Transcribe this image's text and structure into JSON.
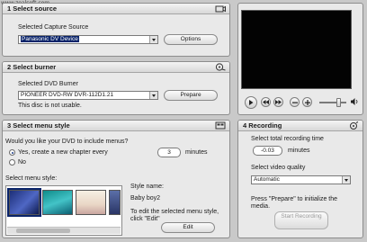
{
  "watermark": "www.zealsoft.com",
  "source": {
    "title": "1 Select source",
    "label": "Selected Capture Source",
    "value": "Panasonic DV Device",
    "button": "Options"
  },
  "burner": {
    "title": "2 Select burner",
    "label": "Selected DVD Burner",
    "value": "PIONEER DVD-RW  DVR-112D1.21",
    "button": "Prepare",
    "status": "This disc is not usable."
  },
  "menu_style": {
    "title": "3 Select menu style",
    "question": "Would you like your DVD to include menus?",
    "yes_label": "Yes, create a new chapter every",
    "chapter_minutes": "3",
    "minutes_label": "minutes",
    "no_label": "No",
    "list_label": "Select menu style:",
    "style_name_label": "Style name:",
    "style_name": "Baby boy2",
    "edit_hint": "To edit the selected menu style, click \"Edit\"",
    "edit_button": "Edit"
  },
  "recording": {
    "title": "4 Recording",
    "time_label": "Select total recording time",
    "time_value": "-0.03",
    "minutes_label": "minutes",
    "quality_label": "Select video quality",
    "quality_value": "Automatic",
    "hint": "Press \"Prepare\" to initialize the media.",
    "start_button": "Start Recording"
  },
  "player": {
    "volume_level": 0.7
  },
  "colors": {
    "selection": "#0a246a",
    "panel": "#e9e9e9",
    "video": "#030303"
  }
}
